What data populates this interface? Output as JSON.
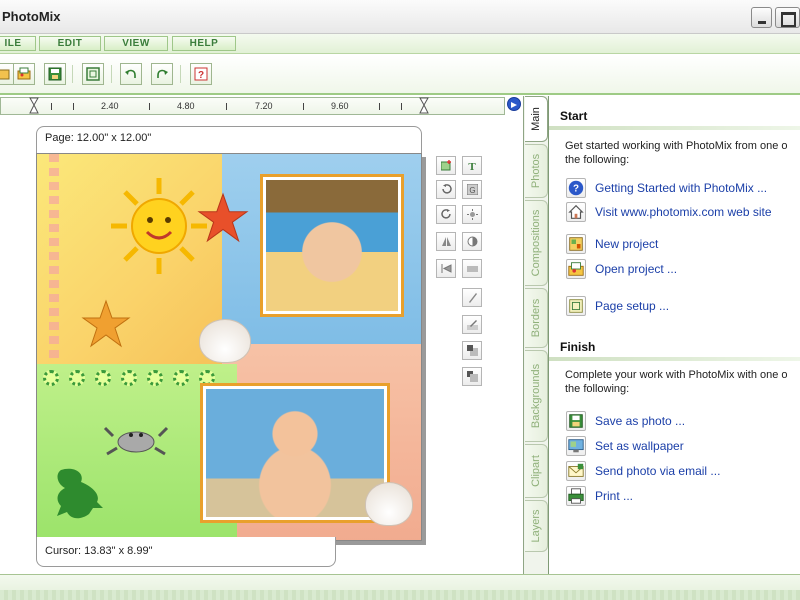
{
  "window": {
    "title": "PhotoMix"
  },
  "menu": {
    "items": [
      "ILE",
      "EDIT",
      "VIEW",
      "HELP"
    ]
  },
  "toolbar": {
    "buttons": [
      "open-photo-icon",
      "open-project-icon",
      "save-icon",
      "page-frame-icon",
      "undo-icon",
      "redo-icon",
      "help-icon"
    ]
  },
  "ruler": {
    "labels": [
      "2.40",
      "4.80",
      "7.20",
      "9.60"
    ]
  },
  "canvas": {
    "page_size": "Page: 12.00\" x 12.00\"",
    "cursor": "Cursor: 13.83\" x 8.99\""
  },
  "palette": {
    "tools": [
      "add-photo-icon",
      "add-text-icon",
      "rotate-left-icon",
      "grayscale-icon",
      "rotate-right-icon",
      "brightness-icon",
      "flip-icon",
      "contrast-icon",
      "mirror-icon",
      "blur-icon",
      "sharpen-icon",
      "edit-icon",
      "bring-front-icon",
      "send-back-icon"
    ]
  },
  "tabs": [
    "Main",
    "Photos",
    "Compositions",
    "Borders",
    "Backgrounds",
    "Clipart",
    "Layers"
  ],
  "panel": {
    "start": {
      "title": "Start",
      "desc_line1": "Get started working with PhotoMix from one o",
      "desc_line2": "the following:",
      "links": [
        {
          "label": "Getting Started with PhotoMix ...",
          "icon": "help-circle-icon"
        },
        {
          "label": "Visit www.photomix.com web site",
          "icon": "home-icon"
        },
        {
          "label": "New project",
          "icon": "new-project-icon"
        },
        {
          "label": "Open project ...",
          "icon": "open-project-icon"
        },
        {
          "label": "Page setup ...",
          "icon": "page-setup-icon"
        }
      ]
    },
    "finish": {
      "title": "Finish",
      "desc_line1": "Complete your work with PhotoMix with one o",
      "desc_line2": "the following:",
      "links": [
        {
          "label": "Save as photo ...",
          "icon": "save-photo-icon"
        },
        {
          "label": "Set as wallpaper",
          "icon": "wallpaper-icon"
        },
        {
          "label": "Send photo via email ...",
          "icon": "email-icon"
        },
        {
          "label": "Print ...",
          "icon": "print-icon"
        }
      ]
    }
  }
}
